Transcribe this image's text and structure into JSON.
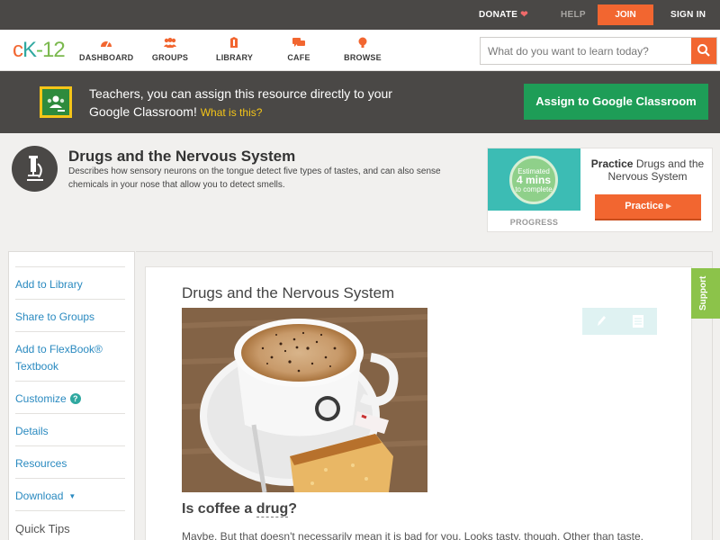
{
  "topbar": {
    "donate": "DONATE",
    "help": "HELP",
    "join": "JOIN",
    "signin": "SIGN IN"
  },
  "nav": {
    "logo_c": "c",
    "logo_k": "K",
    "logo_dash": "-",
    "logo_num": "12",
    "items": [
      {
        "label": "DASHBOARD",
        "icon": "dashboard-icon"
      },
      {
        "label": "GROUPS",
        "icon": "groups-icon"
      },
      {
        "label": "LIBRARY",
        "icon": "library-icon"
      },
      {
        "label": "CAFE",
        "icon": "cafe-icon"
      },
      {
        "label": "BROWSE",
        "icon": "browse-icon"
      }
    ],
    "search_placeholder": "What do you want to learn today?"
  },
  "banner": {
    "text": "Teachers, you can assign this resource directly to your Google Classroom!",
    "link": "What is this?",
    "button": "Assign to Google Classroom"
  },
  "header": {
    "title": "Drugs and the Nervous System",
    "description": "Describes how sensory neurons on the tongue detect five types of tastes, and can also sense chemicals in your nose that allow you to detect smells."
  },
  "progress": {
    "estimated": "Estimated",
    "mins": "4 mins",
    "to_complete": "to complete",
    "label": "PROGRESS",
    "title_bold": "Practice",
    "title_rest": " Drugs and the Nervous System",
    "button": "Practice"
  },
  "sidebar": {
    "items": [
      {
        "label": "Add to Library"
      },
      {
        "label": "Share to Groups"
      },
      {
        "label": "Add to FlexBook® Textbook"
      },
      {
        "label": "Customize"
      },
      {
        "label": "Details"
      },
      {
        "label": "Resources"
      },
      {
        "label": "Download"
      },
      {
        "label": "Quick Tips"
      }
    ]
  },
  "content": {
    "title": "Drugs and the Nervous System",
    "subhead_pre": "Is coffee a ",
    "subhead_word": "drug",
    "subhead_post": "?",
    "paragraph": "Maybe. But that doesn't necessarily mean it is bad for you. Looks tasty, though. Other than taste,"
  },
  "support": "Support",
  "colors": {
    "accent": "#f26630",
    "link": "#2a8ac0",
    "google_green": "#1e9d57",
    "dark": "#4a4846"
  }
}
